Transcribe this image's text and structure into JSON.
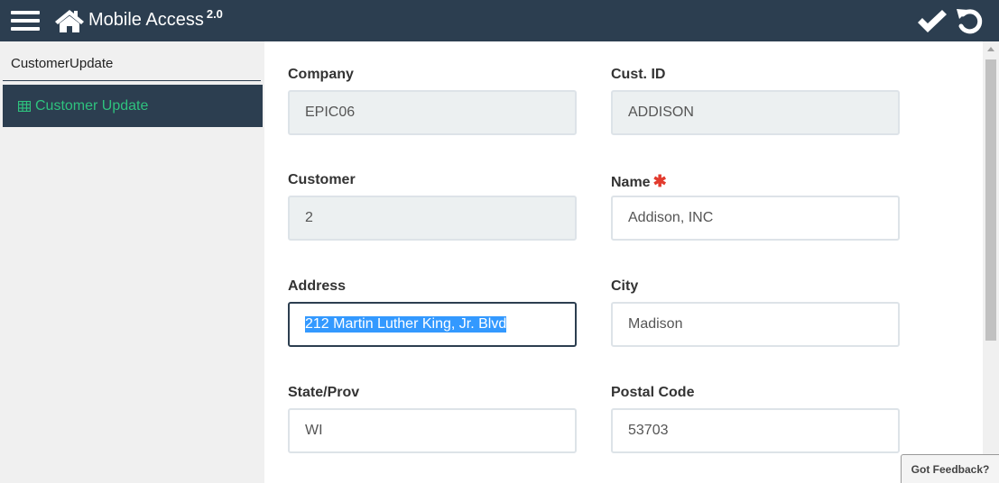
{
  "header": {
    "title": "Mobile Access",
    "version": "2.0",
    "icons": [
      "menu-icon",
      "home-icon",
      "check-icon",
      "undo-icon"
    ]
  },
  "sidebar": {
    "title": "CustomerUpdate",
    "items": [
      {
        "label": "Customer Update",
        "icon": "grid-icon"
      }
    ]
  },
  "form": {
    "company": {
      "label": "Company",
      "value": "EPIC06"
    },
    "cust_id": {
      "label": "Cust. ID",
      "value": "ADDISON"
    },
    "customer": {
      "label": "Customer",
      "value": "2"
    },
    "name": {
      "label": "Name",
      "value": "Addison, INC",
      "required_mark": "✱"
    },
    "address": {
      "label": "Address",
      "value": "212 Martin Luther King, Jr. Blvd"
    },
    "city": {
      "label": "City",
      "value": "Madison"
    },
    "state": {
      "label": "State/Prov",
      "value": "WI"
    },
    "postal": {
      "label": "Postal Code",
      "value": "53703"
    }
  },
  "feedback": {
    "label": "Got Feedback?"
  },
  "colors": {
    "header_bg": "#2c3e50",
    "accent_green": "#2ec27e",
    "required_red": "#e23b2e",
    "selection_blue": "#3399ff"
  }
}
